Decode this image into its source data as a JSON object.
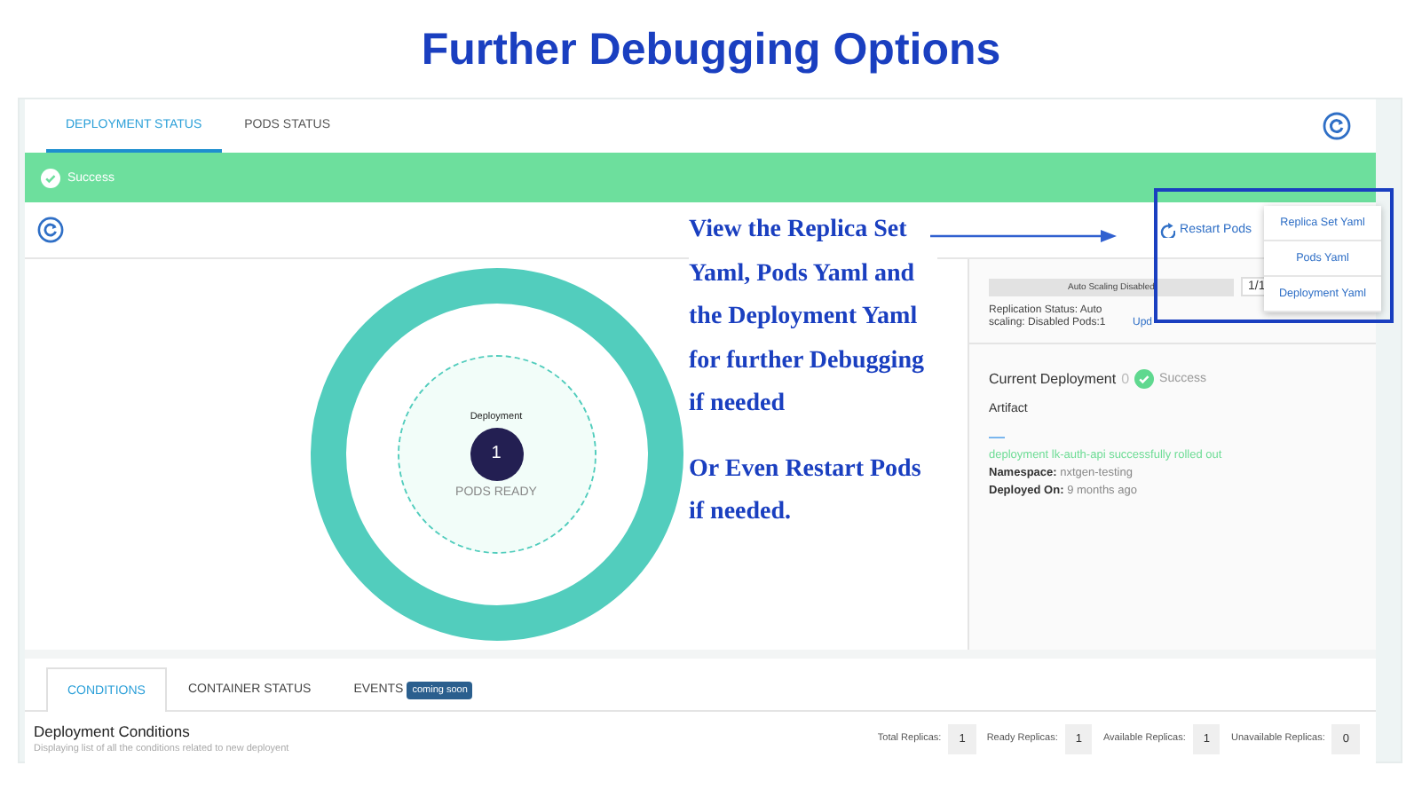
{
  "slide_title": "Further Debugging Options",
  "tabs": [
    {
      "label": "DEPLOYMENT STATUS",
      "selected": true
    },
    {
      "label": "PODS STATUS",
      "selected": false
    }
  ],
  "alert": {
    "text": "Success"
  },
  "toolbar": {
    "restart_button": "Restart Pods"
  },
  "menu": {
    "items": [
      "Replica Set Yaml",
      "Pods Yaml",
      "Deployment Yaml"
    ]
  },
  "annotation": {
    "paragraphs": [
      "View the Replica Set Yaml, Pods Yaml and the Deployment Yaml for further Debugging if needed",
      "Or Even Restart Pods if needed."
    ]
  },
  "pods_ring": {
    "title": "Deployment",
    "count": "1",
    "caption": "PODS READY"
  },
  "scaling": {
    "bar_label": "Auto Scaling Disabled",
    "pods": "1/1",
    "status": "Replication Status: Auto scaling: Disabled Pods:1",
    "link": "Upd"
  },
  "current_deployment": {
    "title": "Current Deployment",
    "info": "0",
    "status": "Success",
    "artifact_label": "Artifact",
    "message": "deployment lk-auth-api successfully rolled out",
    "namespace_label": "Namespace:",
    "namespace": "nxtgen-testing",
    "deployed_label": "Deployed On:",
    "deployed": "9 months ago"
  },
  "bottom_tabs": [
    {
      "label": "CONDITIONS",
      "selected": true
    },
    {
      "label": "CONTAINER STATUS",
      "selected": false
    },
    {
      "label": "EVENTS",
      "selected": false,
      "badge": "coming soon"
    }
  ],
  "conditions": {
    "title": "Deployment Conditions",
    "subtitle": "Displaying list of all the conditions related to new deployent",
    "stats": [
      {
        "label": "Total Replicas:",
        "value": "1"
      },
      {
        "label": "Ready Replicas:",
        "value": "1"
      },
      {
        "label": "Available Replicas:",
        "value": "1"
      },
      {
        "label": "Unavailable Replicas:",
        "value": "0"
      }
    ]
  }
}
